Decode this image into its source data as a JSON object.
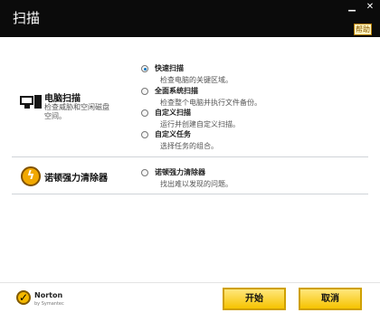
{
  "window": {
    "title": "扫描",
    "minimize": "▁",
    "close": "✕",
    "help": "帮助"
  },
  "computer_scan": {
    "title": "电脑扫描",
    "description": "检查威胁和空闲磁盘空间。",
    "options": [
      {
        "label": "快速扫描",
        "description": "检查电脑的关键区域。",
        "checked": true
      },
      {
        "label": "全面系统扫描",
        "description": "检查整个电脑并执行文件备份。",
        "checked": false
      },
      {
        "label": "自定义扫描",
        "description": "运行并创建自定义扫描。",
        "checked": false
      },
      {
        "label": "自定义任务",
        "description": "选择任务的组合。",
        "checked": false
      }
    ]
  },
  "vanish": {
    "title": "诺顿强力清除器",
    "option": {
      "label": "诺顿强力清除器",
      "description": "找出难以发现的问题。",
      "checked": false
    }
  },
  "brand": {
    "name": "Norton",
    "subtitle": "by Symantec"
  },
  "buttons": {
    "start": "开始",
    "cancel": "取消"
  },
  "colors": {
    "accent": "#f6c300",
    "radio_selected": "#0a75c2",
    "titlebar": "#0b0b0b"
  }
}
